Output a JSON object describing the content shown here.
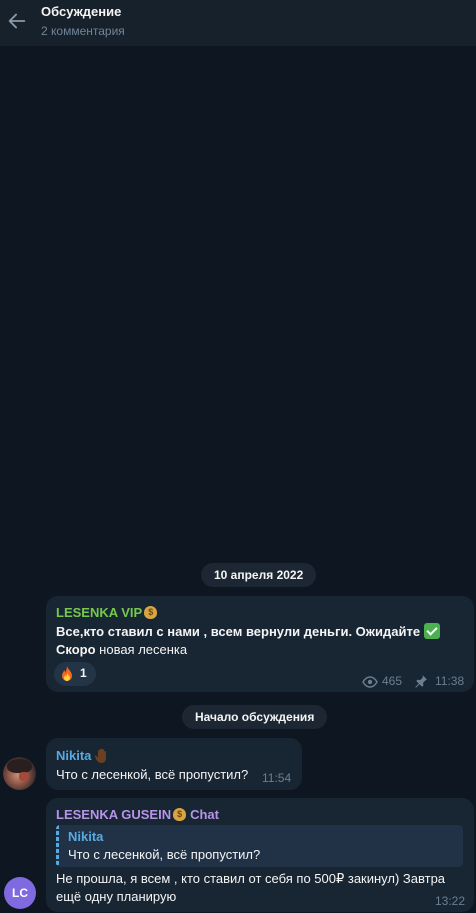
{
  "header": {
    "title": "Обсуждение",
    "subtitle": "2 комментария",
    "back_icon": "arrow-left-icon"
  },
  "date_separator": "10 апреля 2022",
  "discussion_start": "Начало обсуждения",
  "post": {
    "sender": "LESENKA VIP",
    "sender_emoji": "money-bag",
    "line1": "Все,кто ставил с нами , всем вернули деньги. Ожидайте",
    "line1_emoji": "check-mark-button",
    "line2_bold": "Скоро",
    "line2_rest": " новая лесенка",
    "reaction": {
      "emoji": "fire",
      "count": "1"
    },
    "views": "465",
    "pinned": true,
    "time": "11:38"
  },
  "comment1": {
    "sender": "Nikita",
    "sender_emoji": "waving-hand",
    "text": "Что с лесенкой, всё пропустил?",
    "time": "11:54"
  },
  "comment2": {
    "sender": "LESENKA GUSEIN",
    "sender_emoji": "money-bag",
    "tag": "Chat",
    "reply_to": {
      "name": "Nikita",
      "text": "Что с лесенкой, всё пропустил?"
    },
    "line1": "Не прошла, я всем , кто ставил от себя по 500₽ закинул) Завтра",
    "line2": "ещё одну планирую",
    "time": "13:22",
    "avatar_initials": "LC"
  },
  "colors": {
    "background": "#0e1621",
    "header": "#17212b",
    "bubble": "#182533",
    "green_name": "#76c84d",
    "blue_name": "#58a9e0",
    "purple_name": "#b694e6",
    "muted": "#6d7f8f"
  }
}
